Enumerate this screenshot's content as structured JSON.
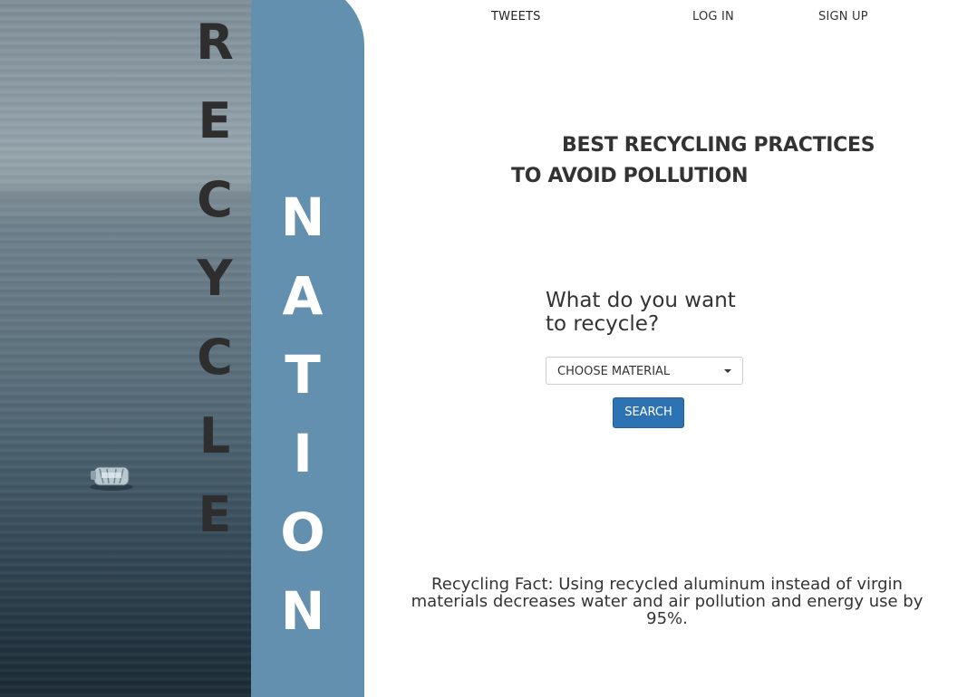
{
  "brand": {
    "word_1_letters": [
      "R",
      "E",
      "C",
      "Y",
      "C",
      "L",
      "E"
    ],
    "word_2_letters": [
      "N",
      "A",
      "T",
      "I",
      "O",
      "N"
    ],
    "panel_color": "#6490b0"
  },
  "nav": {
    "tweets": "TWEETS",
    "login": "LOG IN",
    "signup": "SIGN UP"
  },
  "hero": {
    "line_1": "BEST RECYCLING PRACTICES",
    "line_2": "TO AVOID POLLUTION"
  },
  "search": {
    "question": "What do you want to recycle?",
    "select_value": "CHOOSE MATERIAL",
    "button_label": "SEARCH",
    "button_color": "#2d73b3"
  },
  "fact": {
    "text": "Recycling Fact: Using recycled aluminum instead of virgin materials decreases water and air pollution and energy use by 95%."
  },
  "icons": {
    "dropdown": "chevron-down-icon"
  }
}
